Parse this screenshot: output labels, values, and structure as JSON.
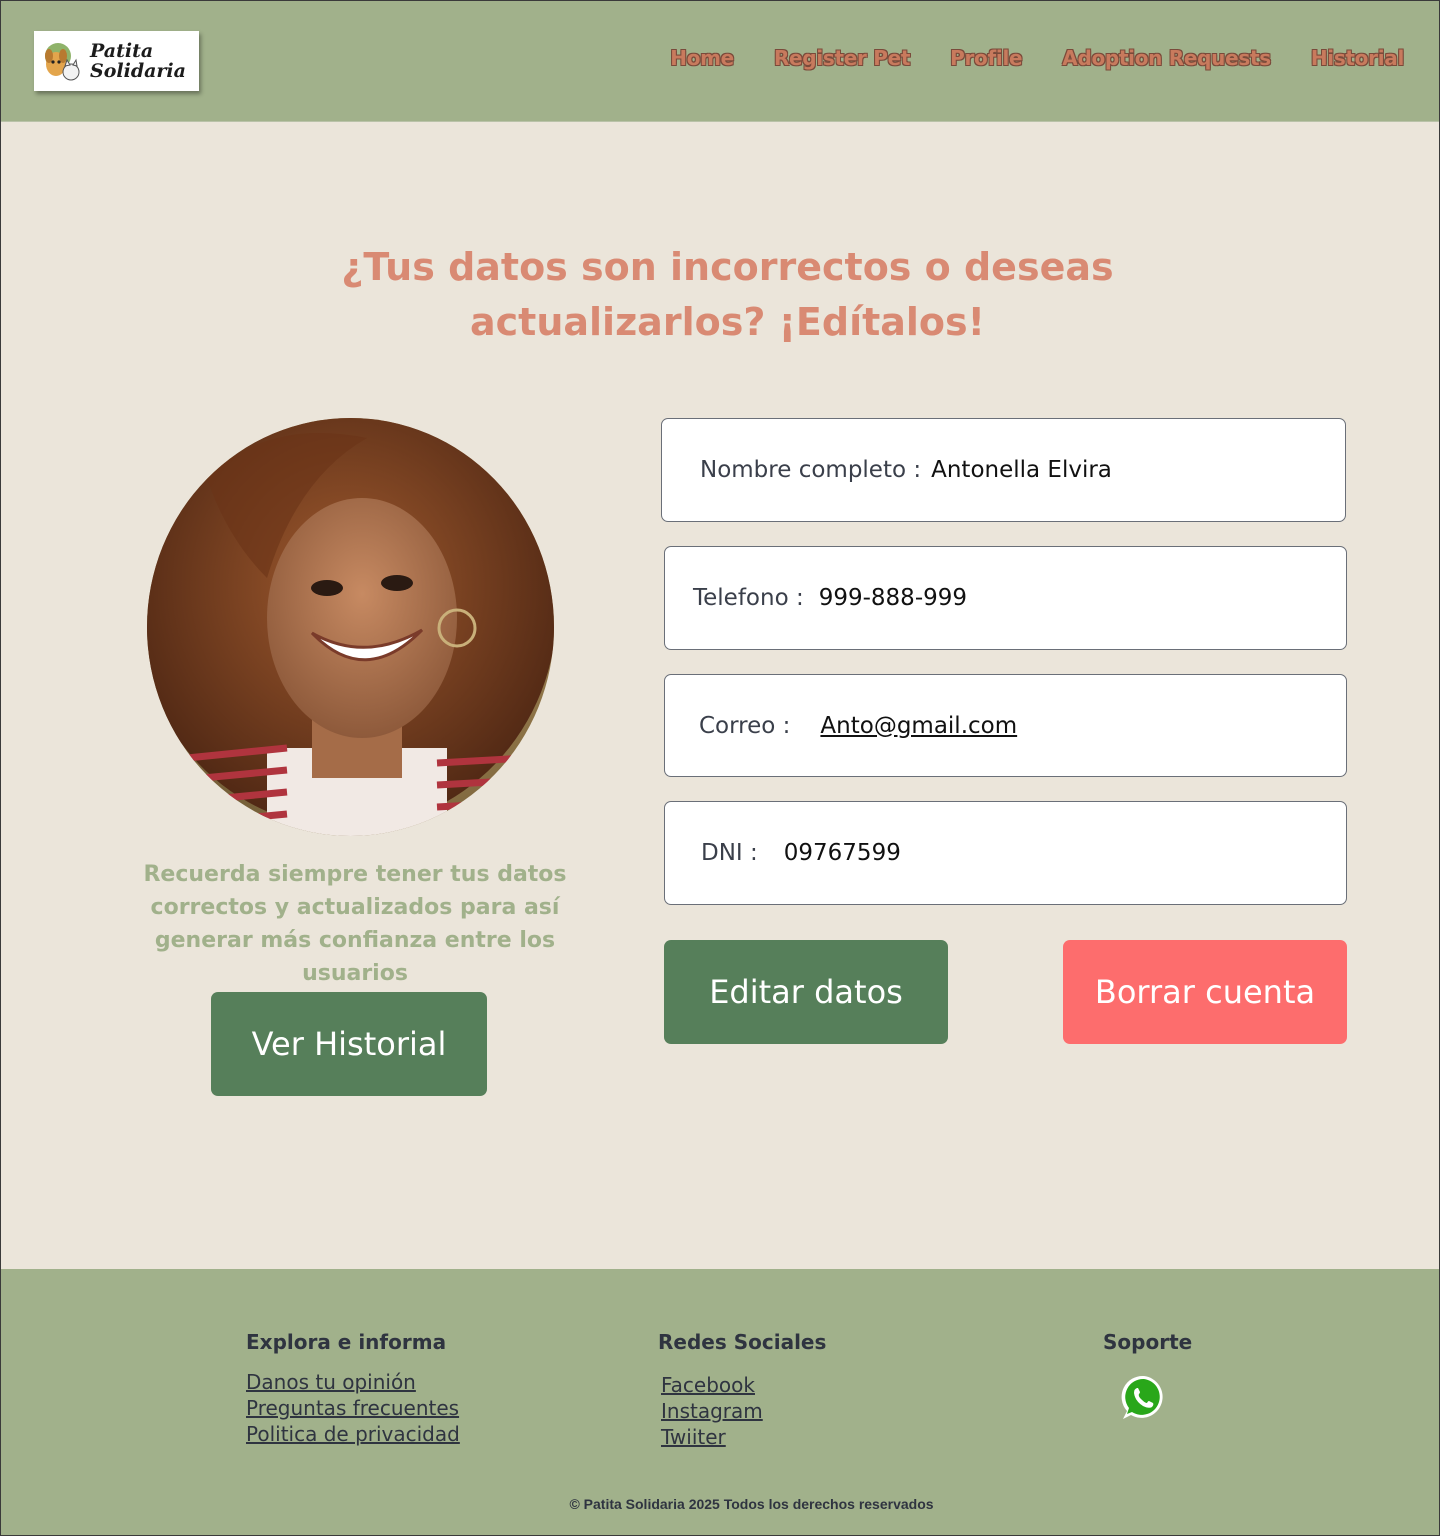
{
  "header": {
    "logo": {
      "line1": "Patita",
      "line2": "Solidaria"
    },
    "nav": [
      "Home",
      "Register Pet",
      "Profile",
      "Adoption Requests",
      "Historial"
    ]
  },
  "main": {
    "title": "¿Tus datos son incorrectos o deseas actualizarlos? ¡Edítalos!",
    "reminder": "Recuerda siempre tener tus datos correctos y actualizados para así generar más confianza entre los usuarios",
    "buttons": {
      "history": "Ver Historial",
      "edit": "Editar datos",
      "delete": "Borrar cuenta"
    },
    "fields": {
      "name": {
        "label": "Nombre completo :",
        "value": "Antonella Elvira"
      },
      "phone": {
        "label": "Telefono :",
        "value": "999-888-999"
      },
      "email": {
        "label": "Correo :",
        "value": "Anto@gmail.com"
      },
      "dni": {
        "label": "DNI :",
        "value": "09767599"
      }
    }
  },
  "footer": {
    "explore": {
      "title": "Explora e informa",
      "links": [
        "Danos tu opinión",
        "Preguntas frecuentes",
        "Politica de privacidad"
      ]
    },
    "social": {
      "title": "Redes Sociales",
      "links": [
        "Facebook",
        "Instagram",
        "Twiiter"
      ]
    },
    "support": {
      "title": "Soporte",
      "icon": "whatsapp-icon"
    },
    "copyright": "© Patita Solidaria 2025 Todos los derechos reservados"
  },
  "colors": {
    "header_bg": "#a1b18b",
    "page_bg": "#ebe5da",
    "accent_orange": "#d98a73",
    "button_green": "#567f5a",
    "button_red": "#fd6d6d"
  }
}
